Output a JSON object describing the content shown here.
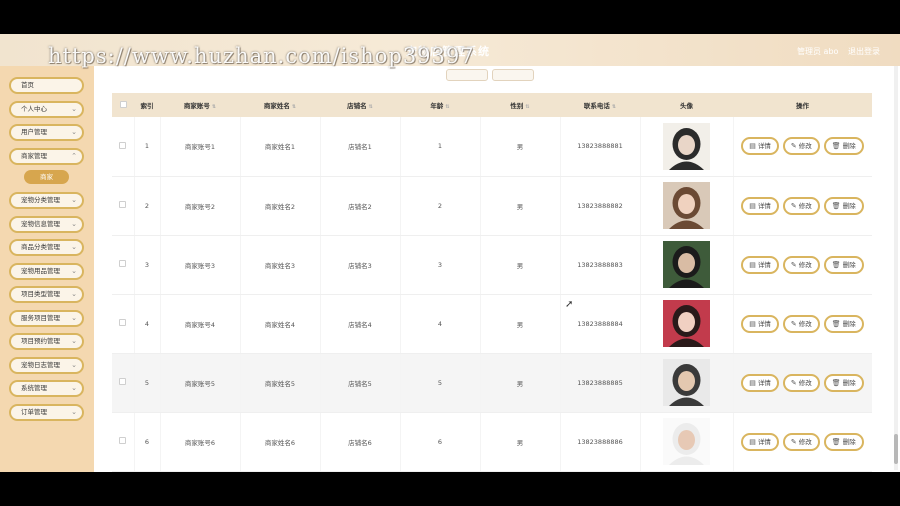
{
  "header": {
    "title": "宠物店管理系统",
    "user": "管理员 abo",
    "logout": "退出登录",
    "watermark": "https://www.huzhan.com/ishop39397"
  },
  "sidebar": {
    "items": [
      {
        "label": "首页",
        "top": 0
      },
      {
        "label": "个人中心"
      },
      {
        "label": "用户管理"
      },
      {
        "label": "商家管理"
      },
      {
        "label": "宠物分类管理"
      },
      {
        "label": "宠物信息管理"
      },
      {
        "label": "商品分类管理"
      },
      {
        "label": "宠物用品管理"
      },
      {
        "label": "项目类型管理"
      },
      {
        "label": "服务项目管理"
      },
      {
        "label": "项目预约管理"
      },
      {
        "label": "宠物日志管理"
      },
      {
        "label": "系统管理"
      },
      {
        "label": "订单管理"
      }
    ],
    "sub_item": "商家"
  },
  "table": {
    "columns": [
      "索引",
      "商家账号",
      "商家姓名",
      "店铺名",
      "年龄",
      "性别",
      "联系电话",
      "头像",
      "操作"
    ],
    "rows": [
      {
        "index": "1",
        "account": "商家账号1",
        "name": "商家姓名1",
        "shop": "店铺名1",
        "age": "1",
        "gender": "男",
        "phone": "13823888881"
      },
      {
        "index": "2",
        "account": "商家账号2",
        "name": "商家姓名2",
        "shop": "店铺名2",
        "age": "2",
        "gender": "男",
        "phone": "13823888882"
      },
      {
        "index": "3",
        "account": "商家账号3",
        "name": "商家姓名3",
        "shop": "店铺名3",
        "age": "3",
        "gender": "男",
        "phone": "13823888883"
      },
      {
        "index": "4",
        "account": "商家账号4",
        "name": "商家姓名4",
        "shop": "店铺名4",
        "age": "4",
        "gender": "男",
        "phone": "13823888884"
      },
      {
        "index": "5",
        "account": "商家账号5",
        "name": "商家姓名5",
        "shop": "店铺名5",
        "age": "5",
        "gender": "男",
        "phone": "13823888885"
      },
      {
        "index": "6",
        "account": "商家账号6",
        "name": "商家姓名6",
        "shop": "店铺名6",
        "age": "6",
        "gender": "男",
        "phone": "13823888886"
      }
    ],
    "actions": {
      "detail": "详情",
      "edit": "修改",
      "delete": "删除"
    }
  },
  "colors": {
    "accent": "#d9b55f",
    "sidebar": "#f4d8b0",
    "header": "#f1e4cf"
  }
}
